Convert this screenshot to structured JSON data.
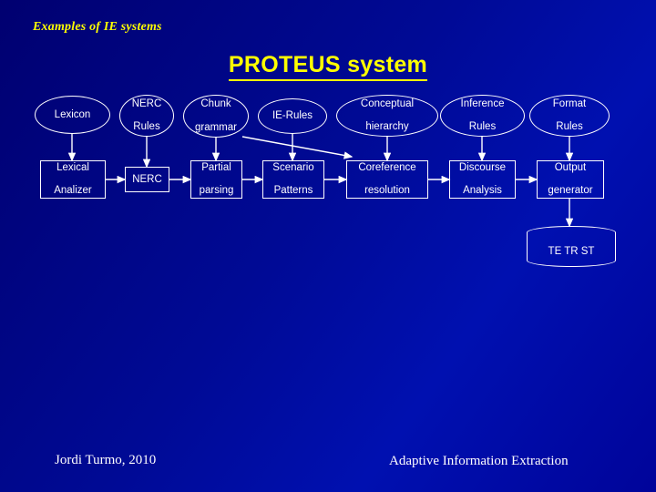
{
  "slide": {
    "kicker": "Examples of IE systems",
    "title": "PROTEUS system",
    "footer_author": "Jordi Turmo, 2010",
    "footer_course": "Adaptive Information Extraction",
    "accent_color": "#ffff00",
    "text_color": "#ffffff",
    "background_color": "#00007a"
  },
  "diagram": {
    "type": "pipeline",
    "resources_row": [
      {
        "id": "lexicon",
        "label": "Lexicon",
        "shape": "ellipse"
      },
      {
        "id": "nerc-rules",
        "label": "NERC\nRules",
        "line1": "NERC",
        "line2": "Rules",
        "shape": "ellipse"
      },
      {
        "id": "chunk-grammar",
        "label": "Chunk\ngrammar",
        "line1": "Chunk",
        "line2": "grammar",
        "shape": "ellipse"
      },
      {
        "id": "ie-rules",
        "label": "IE-Rules",
        "shape": "ellipse"
      },
      {
        "id": "conceptual-hierarchy",
        "label": "Conceptual\nhierarchy",
        "line1": "Conceptual",
        "line2": "hierarchy",
        "shape": "ellipse"
      },
      {
        "id": "inference-rules",
        "label": "Inference\nRules",
        "line1": "Inference",
        "line2": "Rules",
        "shape": "ellipse"
      },
      {
        "id": "format-rules",
        "label": "Format\nRules",
        "line1": "Format",
        "line2": "Rules",
        "shape": "ellipse"
      }
    ],
    "modules_row": [
      {
        "id": "lexical-analizer",
        "label": "Lexical\nAnalizer",
        "line1": "Lexical",
        "line2": "Analizer",
        "shape": "rect"
      },
      {
        "id": "nerc",
        "label": "NERC",
        "shape": "rect"
      },
      {
        "id": "partial-parsing",
        "label": "Partial\nparsing",
        "line1": "Partial",
        "line2": "parsing",
        "shape": "rect"
      },
      {
        "id": "scenario-patterns",
        "label": "Scenario\nPatterns",
        "line1": "Scenario",
        "line2": "Patterns",
        "shape": "rect"
      },
      {
        "id": "coreference-resolution",
        "label": "Coreference\nresolution",
        "line1": "Coreference",
        "line2": "resolution",
        "shape": "rect"
      },
      {
        "id": "discourse-analysis",
        "label": "Discourse\nAnalysis",
        "line1": "Discourse",
        "line2": "Analysis",
        "shape": "rect"
      },
      {
        "id": "output-generator",
        "label": "Output\ngenerator",
        "line1": "Output",
        "line2": "generator",
        "shape": "rect"
      }
    ],
    "store": {
      "id": "te-tr-st-store",
      "label": "TE  TR  ST",
      "shape": "cylinder"
    }
  }
}
